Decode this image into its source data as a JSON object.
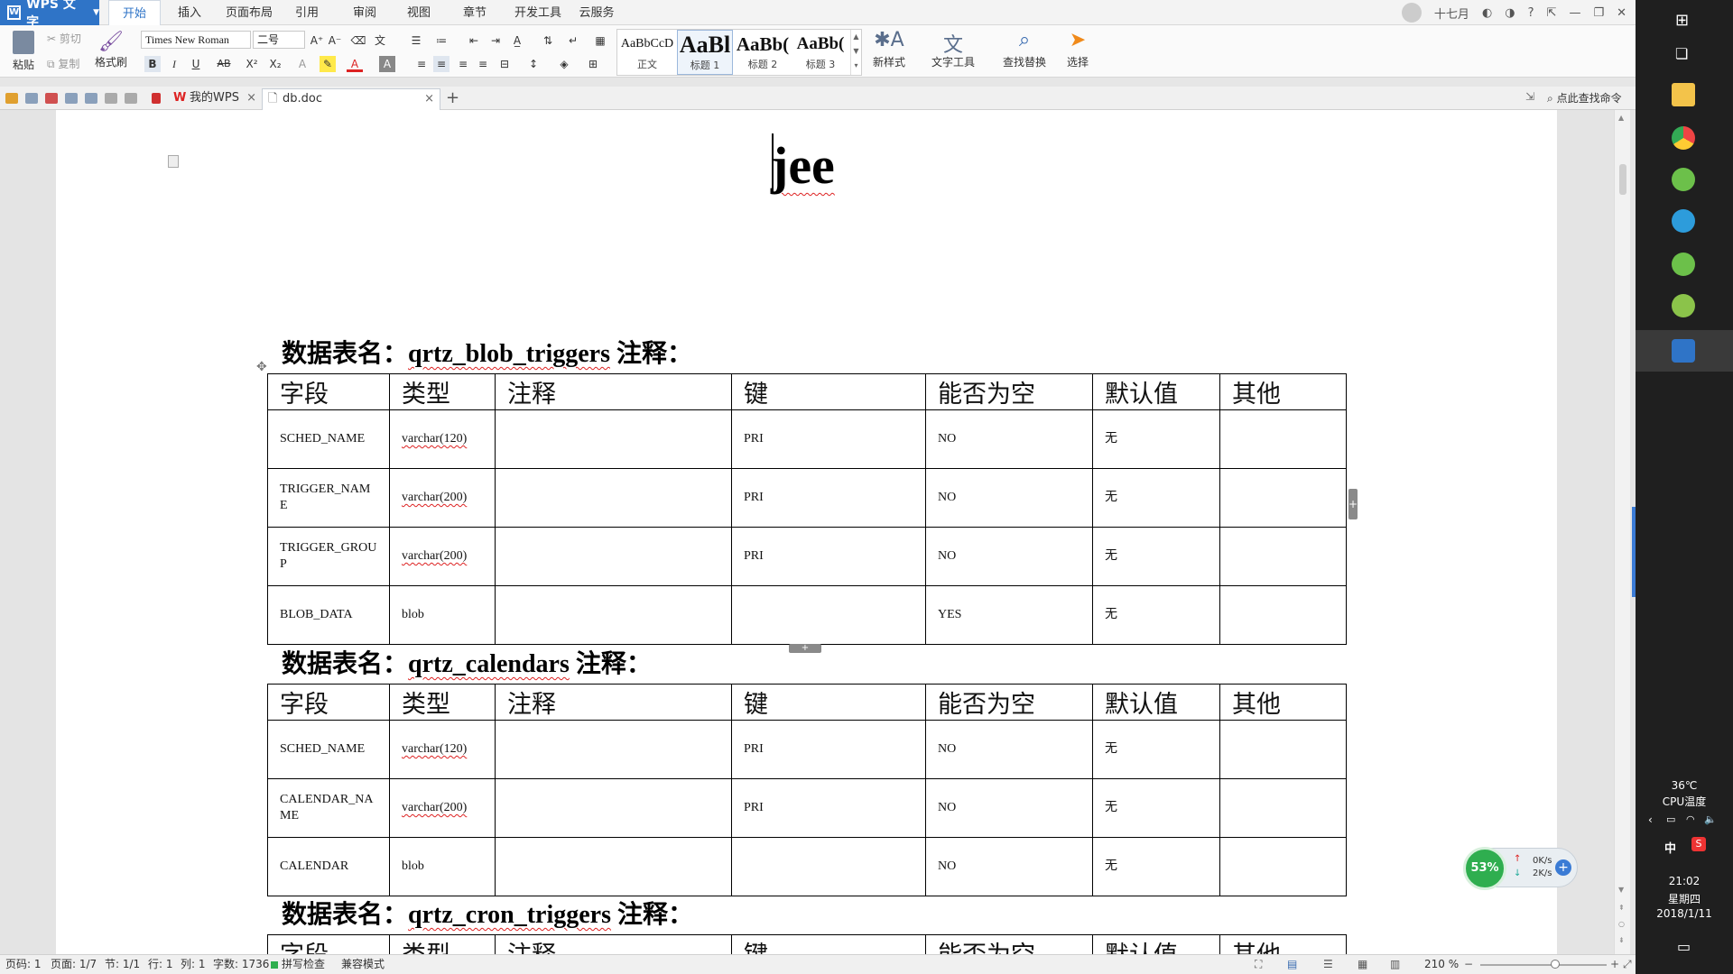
{
  "app": {
    "name": "WPS 文字"
  },
  "menu": {
    "items": [
      "开始",
      "插入",
      "页面布局",
      "引用",
      "审阅",
      "视图",
      "章节",
      "开发工具",
      "云服务"
    ],
    "user": "十七月"
  },
  "ribbon": {
    "paste": "粘贴",
    "cut": "剪切",
    "copy": "复制",
    "format_painter": "格式刷",
    "font_name": "Times New Roman",
    "font_size": "二号",
    "bold": "B",
    "italic": "I",
    "underline": "U",
    "strike": "AB",
    "styles": [
      {
        "preview": "AaBbCcD",
        "name": "正文"
      },
      {
        "preview": "AaBl",
        "name": "标题 1"
      },
      {
        "preview": "AaBb(",
        "name": "标题 2"
      },
      {
        "preview": "AaBb(",
        "name": "标题 3"
      }
    ],
    "new_style": "新样式",
    "text_tools": "文字工具",
    "find_replace": "查找替换",
    "select": "选择"
  },
  "tabs": {
    "items": [
      {
        "label": "我的WPS"
      },
      {
        "label": "db.doc"
      }
    ],
    "search_label": "点此查找命令"
  },
  "document": {
    "title": "jee",
    "columns": [
      "字段",
      "类型",
      "注释",
      "键",
      "能否为空",
      "默认值",
      "其他"
    ],
    "tables": [
      {
        "heading_prefix": "数据表名：",
        "name": "qrtz_blob_triggers",
        "heading_suffix": " 注释：",
        "rows": [
          [
            "SCHED_NAME",
            "varchar(120)",
            "",
            "PRI",
            "NO",
            "无",
            ""
          ],
          [
            "TRIGGER_NAME",
            "varchar(200)",
            "",
            "PRI",
            "NO",
            "无",
            ""
          ],
          [
            "TRIGGER_GROUP",
            "varchar(200)",
            "",
            "PRI",
            "NO",
            "无",
            ""
          ],
          [
            "BLOB_DATA",
            "blob",
            "",
            "",
            "YES",
            "无",
            ""
          ]
        ]
      },
      {
        "heading_prefix": "数据表名：",
        "name": "qrtz_calendars",
        "heading_suffix": " 注释：",
        "rows": [
          [
            "SCHED_NAME",
            "varchar(120)",
            "",
            "PRI",
            "NO",
            "无",
            ""
          ],
          [
            "CALENDAR_NAME",
            "varchar(200)",
            "",
            "PRI",
            "NO",
            "无",
            ""
          ],
          [
            "CALENDAR",
            "blob",
            "",
            "",
            "NO",
            "无",
            ""
          ]
        ]
      },
      {
        "heading_prefix": "数据表名：",
        "name": "qrtz_cron_triggers",
        "heading_suffix": " 注释：",
        "rows": []
      }
    ]
  },
  "status": {
    "page_code": "页码: 1",
    "pages": "页面: 1/7",
    "section": "节: 1/1",
    "line": "行: 1",
    "col": "列: 1",
    "words": "字数: 1736",
    "spell": "拼写检查",
    "compat": "兼容模式",
    "zoom": "210 %"
  },
  "net_widget": {
    "cpu": "53%",
    "up": "0K/s",
    "down": "2K/s"
  },
  "taskbar": {
    "temp": "36℃",
    "temp_label": "CPU温度",
    "ime": "中",
    "time": "21:02",
    "weekday": "星期四",
    "date": "2018/1/11"
  },
  "colors": {
    "accent": "#2f74c7",
    "spell_error": "#dd2222",
    "cpu_green": "#2fae4f"
  }
}
